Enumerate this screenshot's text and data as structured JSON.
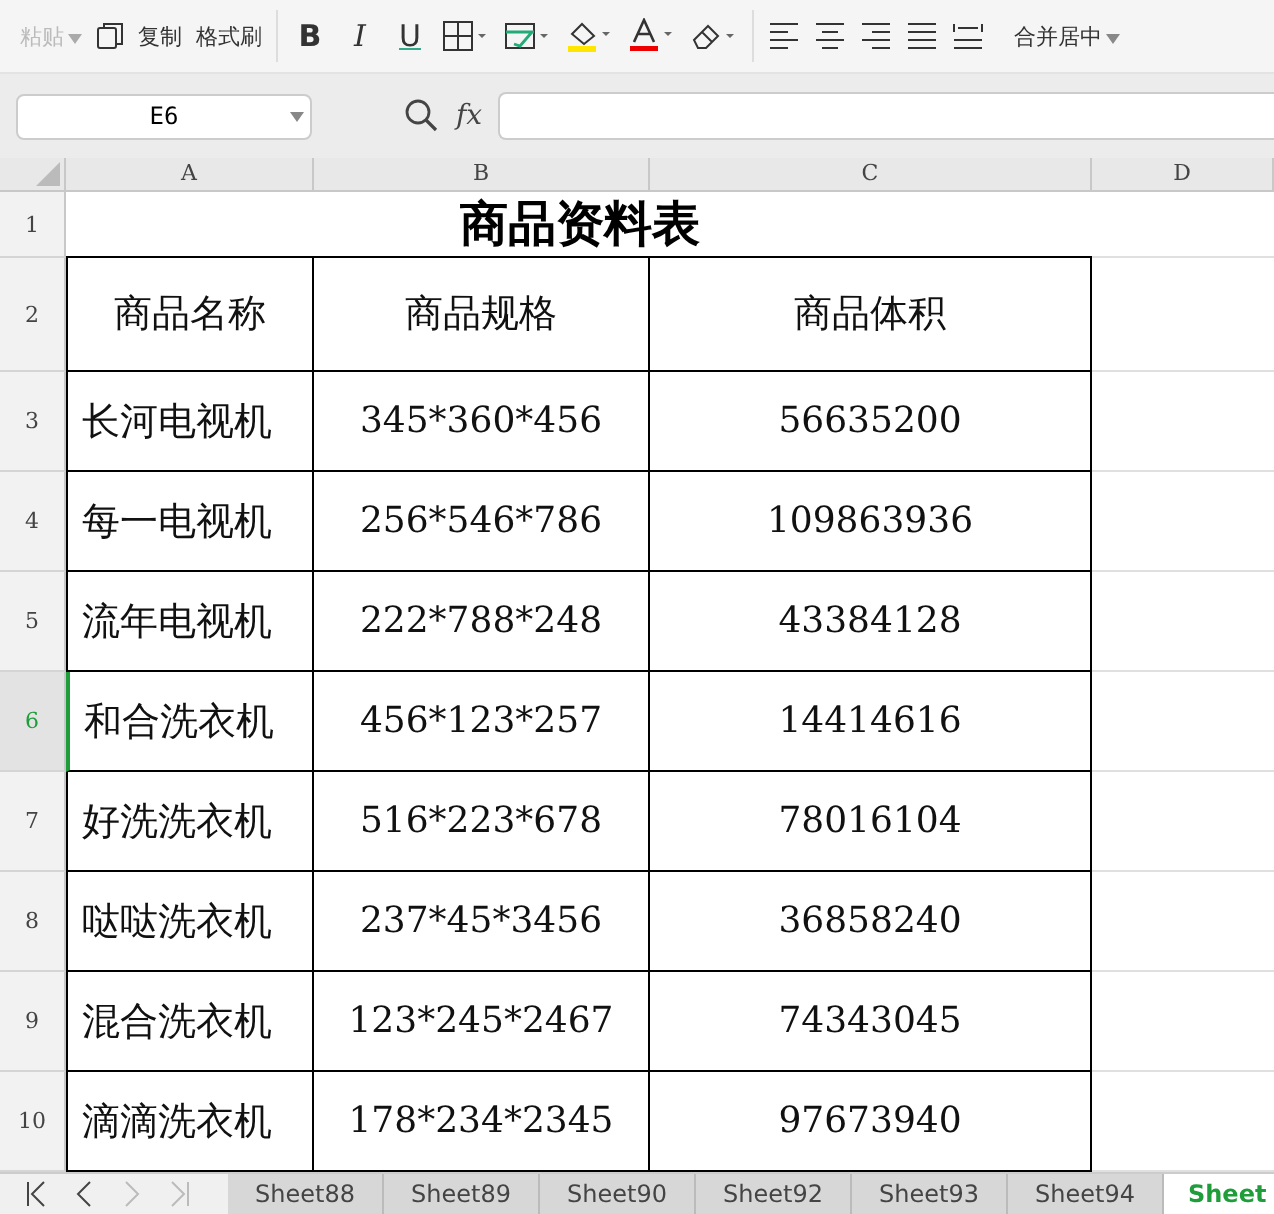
{
  "toolbar": {
    "paste": {
      "label": "粘贴",
      "disabled": true
    },
    "copy": "复制",
    "format_painter": "格式刷",
    "bold": "B",
    "italic": "I",
    "underline": "U",
    "merge_center": "合并居中"
  },
  "name_box": "E6",
  "fx": "fx",
  "columns": [
    {
      "label": "A",
      "selected": false
    },
    {
      "label": "B",
      "selected": false
    },
    {
      "label": "C",
      "selected": false
    },
    {
      "label": "D",
      "selected": false
    }
  ],
  "title_row": {
    "number": "1",
    "selected": false,
    "title": "商品资料表"
  },
  "header_row": {
    "number": "2",
    "selected": false,
    "cells": [
      "商品名称",
      "商品规格",
      "商品体积"
    ]
  },
  "rows": [
    {
      "number": "3",
      "selected": false,
      "cells": [
        "长河电视机",
        "345*360*456",
        "56635200"
      ]
    },
    {
      "number": "4",
      "selected": false,
      "cells": [
        "每一电视机",
        "256*546*786",
        "109863936"
      ]
    },
    {
      "number": "5",
      "selected": false,
      "cells": [
        "流年电视机",
        "222*788*248",
        "43384128"
      ]
    },
    {
      "number": "6",
      "selected": true,
      "cells": [
        "和合洗衣机",
        "456*123*257",
        "14414616"
      ]
    },
    {
      "number": "7",
      "selected": false,
      "cells": [
        "好洗洗衣机",
        "516*223*678",
        "78016104"
      ]
    },
    {
      "number": "8",
      "selected": false,
      "cells": [
        "哒哒洗衣机",
        "237*45*3456",
        "36858240"
      ]
    },
    {
      "number": "9",
      "selected": false,
      "cells": [
        "混合洗衣机",
        "123*245*2467",
        "74343045"
      ]
    },
    {
      "number": "10",
      "selected": false,
      "cells": [
        "滴滴洗衣机",
        "178*234*2345",
        "97673940"
      ]
    }
  ],
  "sheet_tabs": [
    {
      "label": "Sheet88",
      "selected": false
    },
    {
      "label": "Sheet89",
      "selected": false
    },
    {
      "label": "Sheet90",
      "selected": false
    },
    {
      "label": "Sheet92",
      "selected": false
    },
    {
      "label": "Sheet93",
      "selected": false
    },
    {
      "label": "Sheet94",
      "selected": false
    },
    {
      "label": "Sheet",
      "selected": true
    }
  ]
}
